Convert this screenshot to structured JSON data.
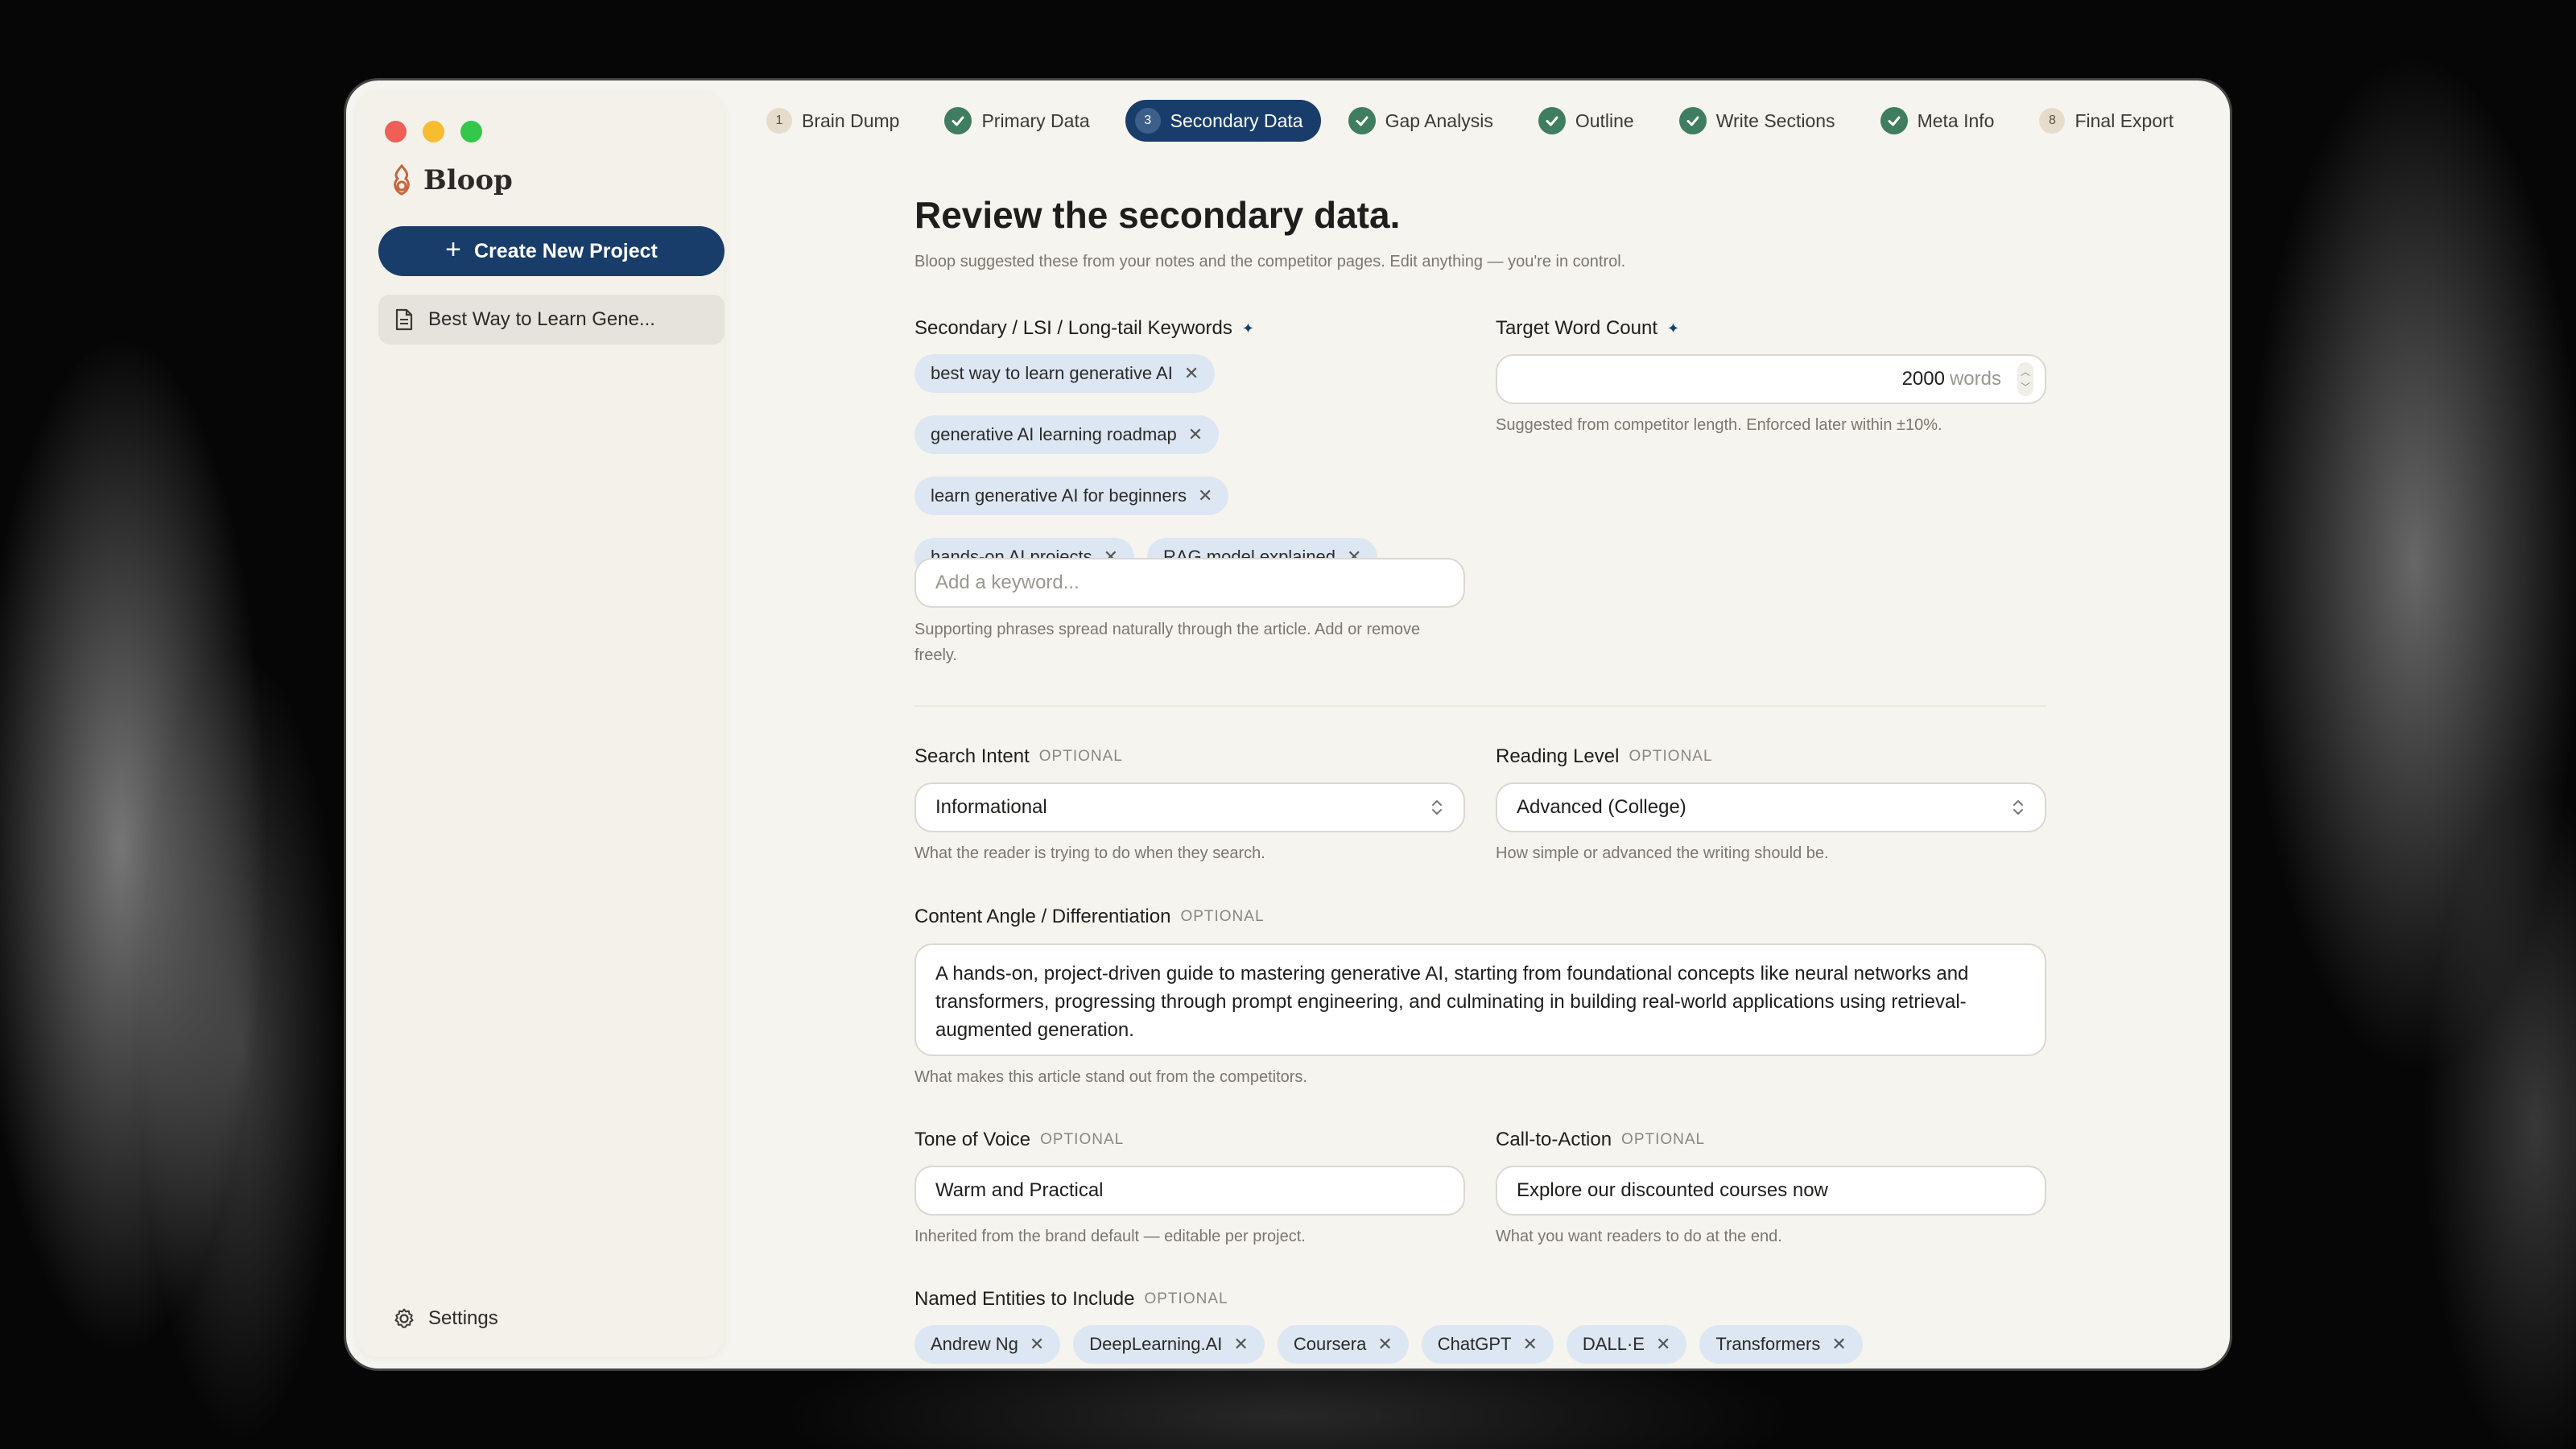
{
  "app": {
    "name": "Bloop",
    "create_button": "Create New Project",
    "project_title": "Best Way to Learn Gene...",
    "settings_label": "Settings"
  },
  "steps": [
    {
      "num": "1",
      "label": "Brain Dump",
      "state": "pending"
    },
    {
      "label": "Primary Data",
      "state": "done"
    },
    {
      "num": "3",
      "label": "Secondary Data",
      "state": "active"
    },
    {
      "label": "Gap Analysis",
      "state": "done"
    },
    {
      "label": "Outline",
      "state": "done"
    },
    {
      "label": "Write Sections",
      "state": "done"
    },
    {
      "label": "Meta Info",
      "state": "done"
    },
    {
      "num": "8",
      "label": "Final Export",
      "state": "pending"
    }
  ],
  "page": {
    "title": "Review the secondary data.",
    "subtitle": "Bloop suggested these from your notes and the competitor pages. Edit anything — you're in control."
  },
  "keywords": {
    "label": "Secondary / LSI / Long-tail Keywords",
    "items": [
      "best way to learn generative AI",
      "generative AI learning roadmap",
      "learn generative AI for beginners",
      "hands-on AI projects",
      "RAG model explained"
    ],
    "placeholder": "Add a keyword...",
    "help": "Supporting phrases spread naturally through the article. Add or remove freely."
  },
  "word_count": {
    "label": "Target Word Count",
    "value": "2000",
    "unit": "words",
    "help": "Suggested from competitor length. Enforced later within ±10%."
  },
  "optional_tag": "OPTIONAL",
  "search_intent": {
    "label": "Search Intent",
    "value": "Informational",
    "help": "What the reader is trying to do when they search."
  },
  "reading_level": {
    "label": "Reading Level",
    "value": "Advanced (College)",
    "help": "How simple or advanced the writing should be."
  },
  "content_angle": {
    "label": "Content Angle / Differentiation",
    "value": "A hands-on, project-driven guide to mastering generative AI, starting from foundational concepts like neural networks and transformers, progressing through prompt engineering, and culminating in building real-world applications using retrieval-augmented generation.",
    "help": "What makes this article stand out from the competitors."
  },
  "tone": {
    "label": "Tone of Voice",
    "value": "Warm and Practical",
    "help": "Inherited from the brand default — editable per project."
  },
  "cta": {
    "label": "Call-to-Action",
    "value": "Explore our discounted courses now",
    "help": "What you want readers to do at the end."
  },
  "entities": {
    "label": "Named Entities to Include",
    "items": [
      "Andrew Ng",
      "DeepLearning.AI",
      "Coursera",
      "ChatGPT",
      "DALL·E",
      "Transformers"
    ]
  },
  "colors": {
    "accent": "#183d6b",
    "chip_bg": "#dce7f3",
    "check_green": "#3e7d5e",
    "window_bg": "#f6f4ee"
  },
  "icons": {
    "brand": "flame-logo-icon",
    "plus": "plus-icon",
    "document": "document-icon",
    "settings": "gear-icon",
    "step_done": "check-circle-icon",
    "chip_remove": "close-icon",
    "select": "chevron-updown-icon"
  }
}
